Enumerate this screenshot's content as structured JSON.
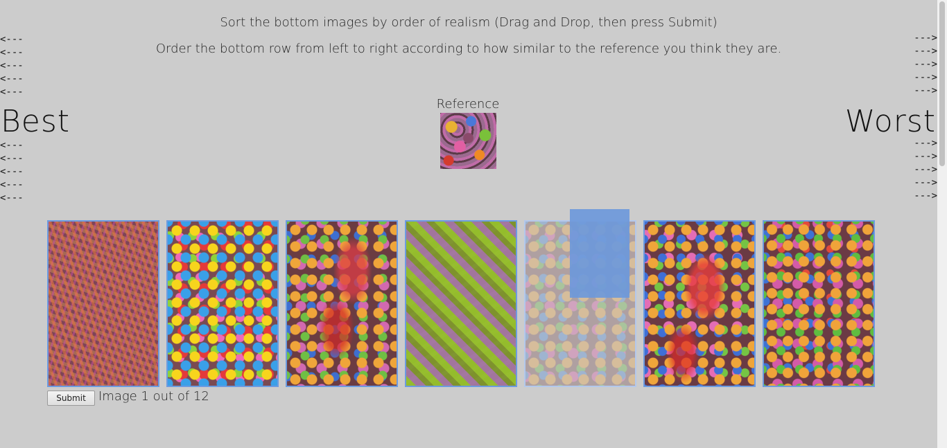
{
  "instructions": {
    "line1": "Sort the bottom images by order of realism (Drag and Drop, then press Submit)",
    "line2": "Order the bottom row from left to right according to how similar to the reference you think they are."
  },
  "arrows": {
    "left": "<---",
    "right": "--->"
  },
  "labels": {
    "best": "Best",
    "worst": "Worst",
    "reference": "Reference"
  },
  "candidates": [
    {
      "name": "candidate-image-1",
      "state": "normal"
    },
    {
      "name": "candidate-image-2",
      "state": "normal"
    },
    {
      "name": "candidate-image-3",
      "state": "normal"
    },
    {
      "name": "candidate-image-4",
      "state": "normal"
    },
    {
      "name": "candidate-image-5",
      "state": "dragging-placeholder"
    },
    {
      "name": "candidate-image-6",
      "state": "normal"
    },
    {
      "name": "candidate-image-7",
      "state": "normal"
    }
  ],
  "footer": {
    "submit_label": "Submit",
    "progress": "Image 1 out of 12"
  },
  "colors": {
    "background": "#cccccc",
    "tile_border": "#6c9be0",
    "drag_overlay": "#6b98dc"
  }
}
